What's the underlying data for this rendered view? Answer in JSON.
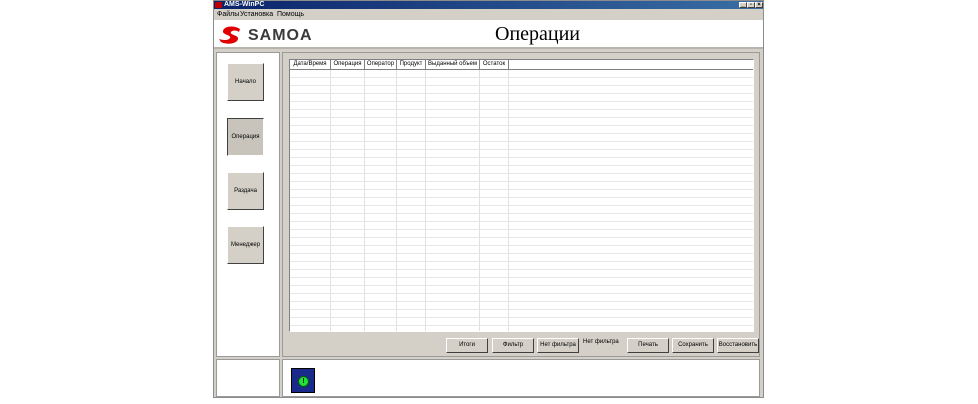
{
  "window": {
    "title": "AMS-WinPC",
    "controls": [
      "_",
      "▫",
      "×"
    ]
  },
  "menu": [
    "Файлы",
    "Установка",
    "Помощь"
  ],
  "header": {
    "logo_text": "SAMOA",
    "page_title": "Операции"
  },
  "sidebar": {
    "items": [
      "Начало",
      "Операция",
      "Раздача",
      "Менеджер"
    ],
    "active_index": 1
  },
  "table": {
    "columns": [
      "Дата/Время",
      "Операция",
      "Оператор",
      "Продукт",
      "Выданный объем",
      "Остаток"
    ],
    "rows": []
  },
  "toolbar": {
    "totals": "Итоги",
    "filter": "Фильтр",
    "no_filter_button": "Нет фильтра",
    "filter_status": "Нет фильтра",
    "print": "Печать",
    "save": "Сохранить",
    "restore": "Восстановить"
  },
  "status": {
    "indicator_icon": "status-ok-icon",
    "indicator_label": "!",
    "indicator_color": "#22e03a"
  },
  "colors": {
    "brand": "#e00000",
    "title_bar": "#0a246a"
  }
}
